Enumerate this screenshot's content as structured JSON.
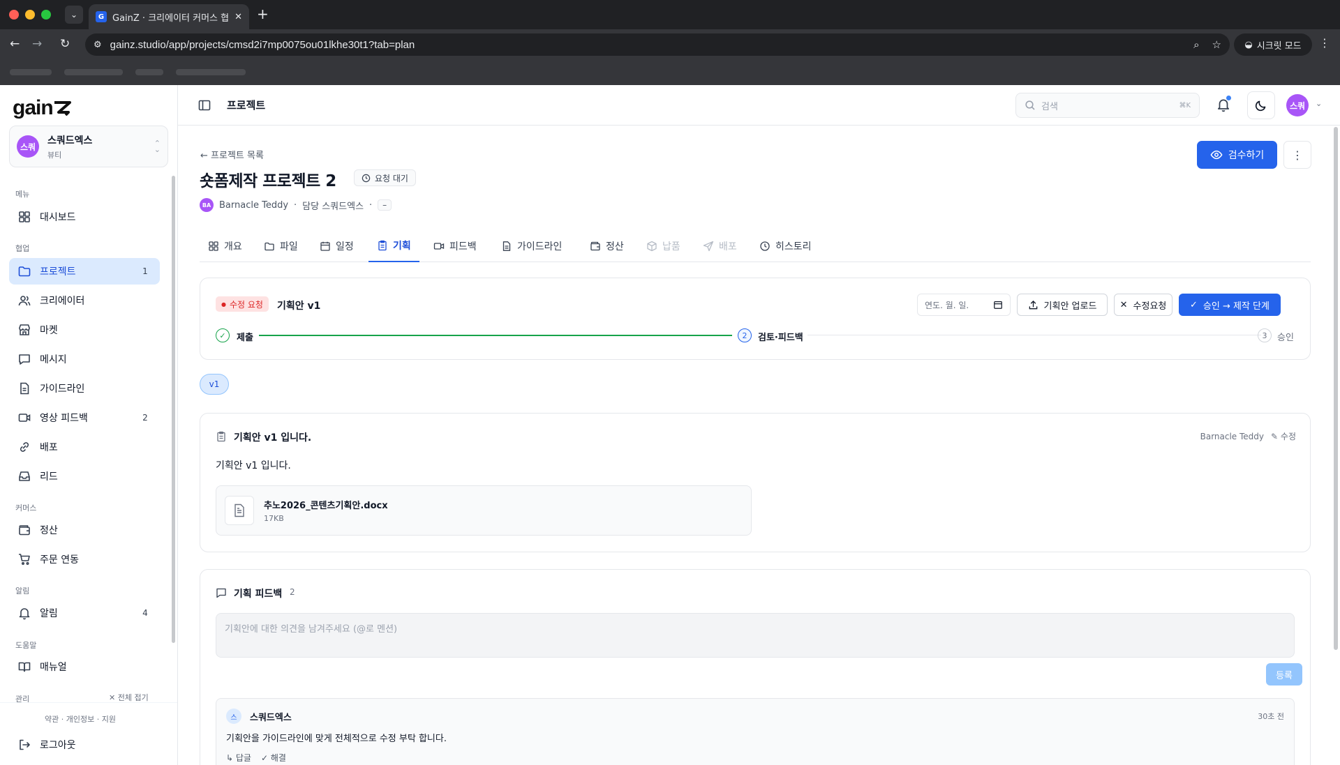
{
  "browser": {
    "tab_title": "GainZ · 크리에이터 커머스 협업 OS",
    "favicon_letter": "G",
    "url": "gainz.studio/app/projects/cmsd2i7mp0075ou01lkhe30t1?tab=plan",
    "incognito_label": "시크릿 모드"
  },
  "sidebar": {
    "logo": "gain",
    "workspace": {
      "avatar": "스쿼",
      "name": "스쿼드엑스",
      "category": "뷰티"
    },
    "sections": {
      "menu": "메뉴",
      "collab": "협업",
      "commerce": "커머스",
      "alerts": "알림",
      "help": "도움말",
      "admin": "관리"
    },
    "items": {
      "dashboard": "대시보드",
      "projects": "프로젝트",
      "projects_badge": "1",
      "creators": "크리에이터",
      "market": "마켓",
      "messages": "메시지",
      "guidelines": "가이드라인",
      "video_feedback": "영상 피드백",
      "video_feedback_badge": "2",
      "distribution": "배포",
      "leads": "리드",
      "settlement": "정산",
      "order_sync": "주문 연동",
      "notifications": "알림",
      "notifications_badge": "4",
      "manual": "매뉴얼"
    },
    "collapse_all": "전체 접기",
    "footer_links": [
      "약관",
      "개인정보",
      "지원"
    ],
    "logout": "로그아웃"
  },
  "topbar": {
    "page": "프로젝트",
    "search_placeholder": "검색",
    "search_shortcut": "⌘K",
    "user_avatar": "스쿼"
  },
  "project": {
    "back_link": "프로젝트 목록",
    "title": "숏폼제작 프로젝트 2",
    "status": "요청 대기",
    "creator_avatar": "BA",
    "creator": "Barnacle Teddy",
    "owner": "담당 스쿼드엑스",
    "extra": "–",
    "review_button": "검수하기"
  },
  "tabs": [
    {
      "label": "개요",
      "disabled": false
    },
    {
      "label": "파일",
      "disabled": false
    },
    {
      "label": "일정",
      "disabled": false
    },
    {
      "label": "기획",
      "disabled": false
    },
    {
      "label": "피드백",
      "disabled": false
    },
    {
      "label": "가이드라인",
      "disabled": false
    },
    {
      "label": "정산",
      "disabled": false
    },
    {
      "label": "납품",
      "disabled": true
    },
    {
      "label": "배포",
      "disabled": true
    },
    {
      "label": "히스토리",
      "disabled": false
    }
  ],
  "plan": {
    "status_pill": "수정 요청",
    "version_label": "기획안 v1",
    "date_placeholder": "연도. 월. 일.",
    "upload_button": "기획안 업로드",
    "request_revision_button": "수정요청",
    "approve_button": "승인 → 제작 단계",
    "steps": [
      {
        "number": "✓",
        "label": "제출",
        "state": "done"
      },
      {
        "number": "2",
        "label": "검토·피드백",
        "state": "current"
      },
      {
        "number": "3",
        "label": "승인",
        "state": "pending"
      }
    ],
    "version_pill": "v1"
  },
  "document": {
    "title": "기획안 v1 입니다.",
    "author": "Barnacle Teddy",
    "edit_label": "수정",
    "body": "기획안 v1 입니다.",
    "file_name": "추노2026_콘텐츠기획안.docx",
    "file_size": "17KB"
  },
  "feedback": {
    "title": "기획 피드백",
    "count": "2",
    "placeholder": "기획안에 대한 의견을 남겨주세요 (@로 멘션)",
    "submit": "등록",
    "comments": [
      {
        "avatar": "스",
        "author": "스쿼드엑스",
        "time": "30초 전",
        "text": "기획안을 가이드라인에 맞게 전체적으로 수정 부탁 합니다.",
        "reply": "답글",
        "resolve": "해결"
      }
    ]
  },
  "colors": {
    "accent": "#2563eb",
    "accent_light": "#dbeafe",
    "danger": "#dc2626",
    "success": "#16a34a"
  }
}
